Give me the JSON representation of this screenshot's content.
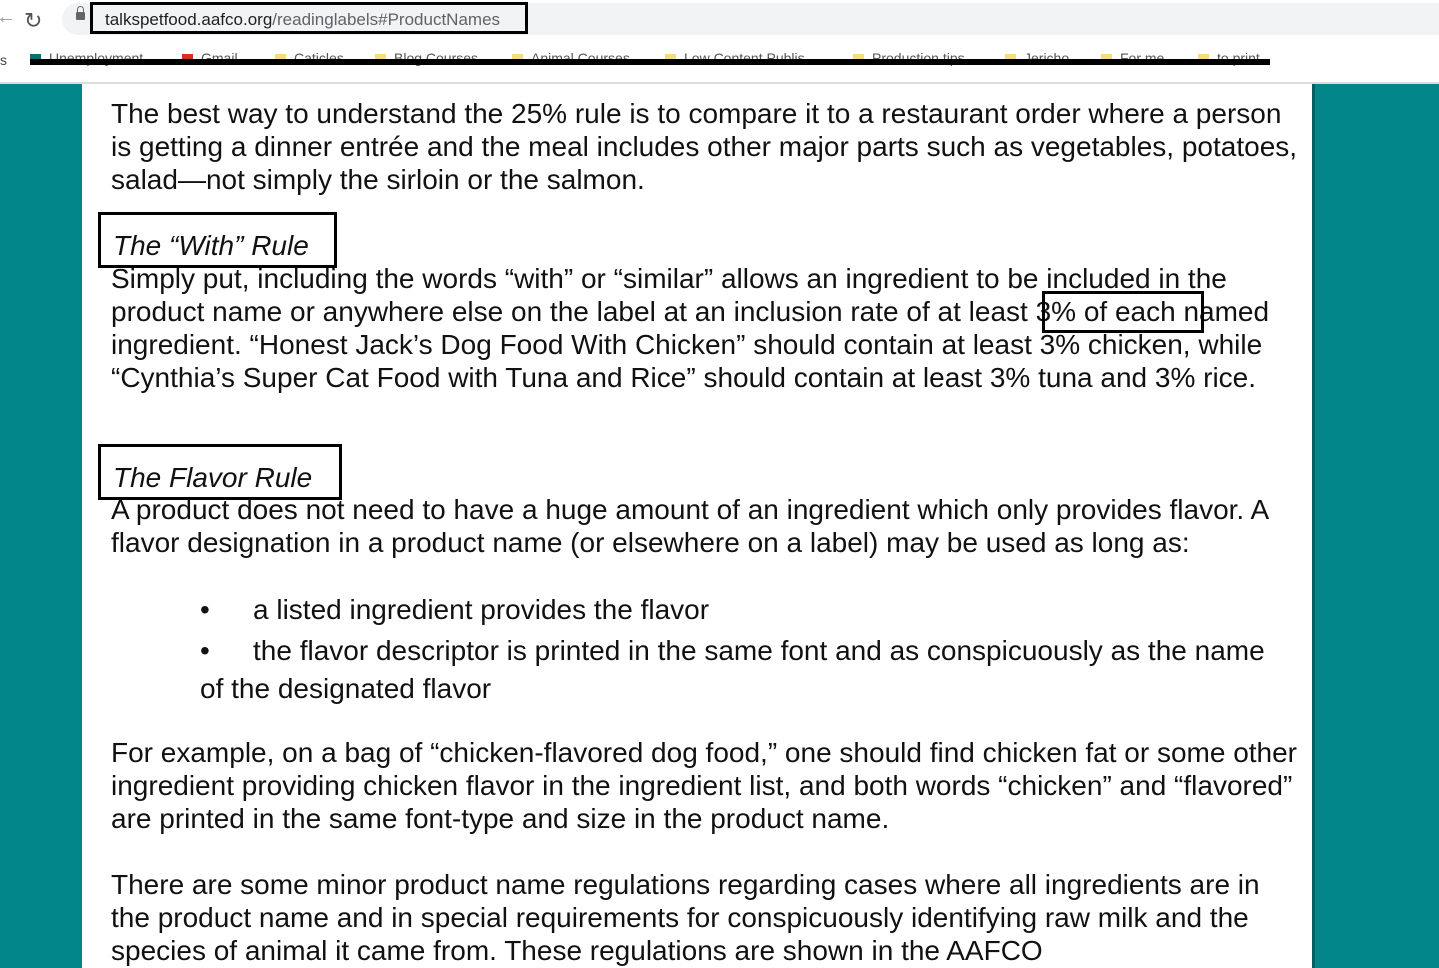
{
  "browser": {
    "url_host": "talkspetfood.aafco.org",
    "url_path": "/readinglabels#ProductNames",
    "bookmarks": [
      "Unemployment",
      "Gmail",
      "Caticles",
      "Blog Courses",
      "Animal Courses",
      "Low Content Publis...",
      "Production tips",
      "Jericho",
      "For me",
      "to print"
    ],
    "bookmarks_prefix": "s"
  },
  "content": {
    "intro": "The best way to understand the 25% rule is to compare it to a restaurant order where a person is getting a dinner entrée and the meal includes other major parts such as vegetables, potatoes, salad—not simply the sirloin or the salmon.",
    "with_heading": "The “With” Rule",
    "with_p1": "Simply put, including the words “with” or “similar” allows an ingredient to be included in the product name or anywhere else on the label at an inclusion rate of ",
    "with_highlight": "at least 3%",
    "with_p2": " of each named ingredient. “Honest Jack’s Dog Food With Chicken” should contain at least 3% chicken, while “Cynthia’s Super Cat Food with Tuna and Rice” should contain at least 3% tuna and 3% rice.",
    "flavor_heading": "The Flavor Rule",
    "flavor_p": "A product does not need to have a huge amount of an ingredient which only provides flavor. A flavor designation in a product name (or elsewhere on a label) may be used as long as:",
    "bullets": [
      "a listed ingredient provides the flavor",
      "the flavor descriptor is printed in the same font and as conspicuously as the name of the designated flavor"
    ],
    "example": "For example, on a bag of “chicken-flavored dog food,” one should find chicken fat or some other ingredient providing chicken flavor in the ingredient list, and both words “chicken” and “flavored” are printed in the same font-type and size in the product name.",
    "minor": "There are some minor product name regulations regarding cases where all ingredients are in the product name and in special requirements for conspicuously identifying raw milk and the species of animal it came from. These regulations are shown in the AAFCO"
  }
}
